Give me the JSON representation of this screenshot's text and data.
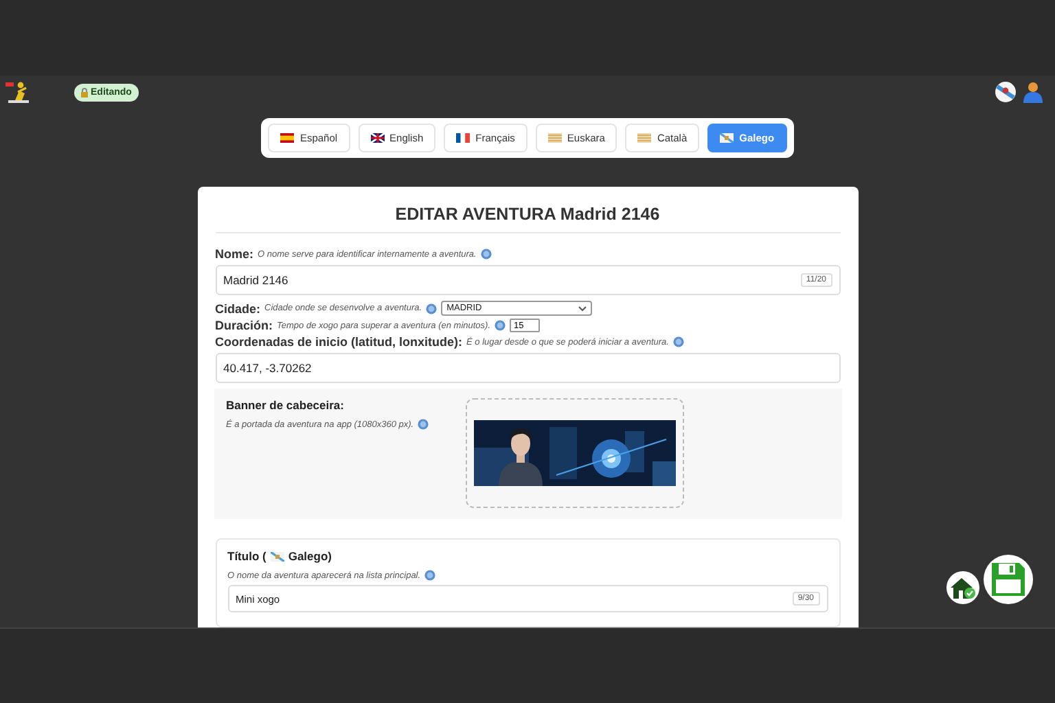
{
  "header": {
    "status_badge": "Editando"
  },
  "languages": [
    {
      "label": "Español",
      "kind": "es",
      "selected": false
    },
    {
      "label": "English",
      "kind": "uk",
      "selected": false
    },
    {
      "label": "Français",
      "kind": "fr",
      "selected": false
    },
    {
      "label": "Euskara",
      "kind": "eu",
      "selected": false
    },
    {
      "label": "Català",
      "kind": "ca",
      "selected": false
    },
    {
      "label": "Galego",
      "kind": "gl",
      "selected": true
    }
  ],
  "form": {
    "title": "EDITAR AVENTURA Madrid 2146",
    "fields": [
      {
        "kind": "text",
        "label": "Nome:",
        "hint": "O nome serve para identificar internamente a aventura.",
        "value": "Madrid 2146",
        "counter": "11/20"
      },
      {
        "kind": "select",
        "label": "Cidade:",
        "hint": "Cidade onde se desenvolve a aventura.",
        "value": "MADRID"
      },
      {
        "kind": "number",
        "label": "Duración:",
        "hint": "Tempo de xogo para superar a aventura (en minutos).",
        "value": "15"
      },
      {
        "kind": "text",
        "label": "Coordenadas de inicio (latitud, lonxitude):",
        "hint": "É o lugar desde o que se poderá iniciar a aventura.",
        "value": "40.417, -3.70262"
      }
    ],
    "banner": {
      "label": "Banner de cabeceira:",
      "hint": "É a portada da aventura na app (1080x360 px)."
    },
    "title_section": {
      "label": "Título (",
      "kind": "gl",
      "label_end": "Galego)",
      "hint": "O nome da aventura aparecerá na lista principal.",
      "value": "Mini xogo",
      "counter": "9/30"
    }
  }
}
